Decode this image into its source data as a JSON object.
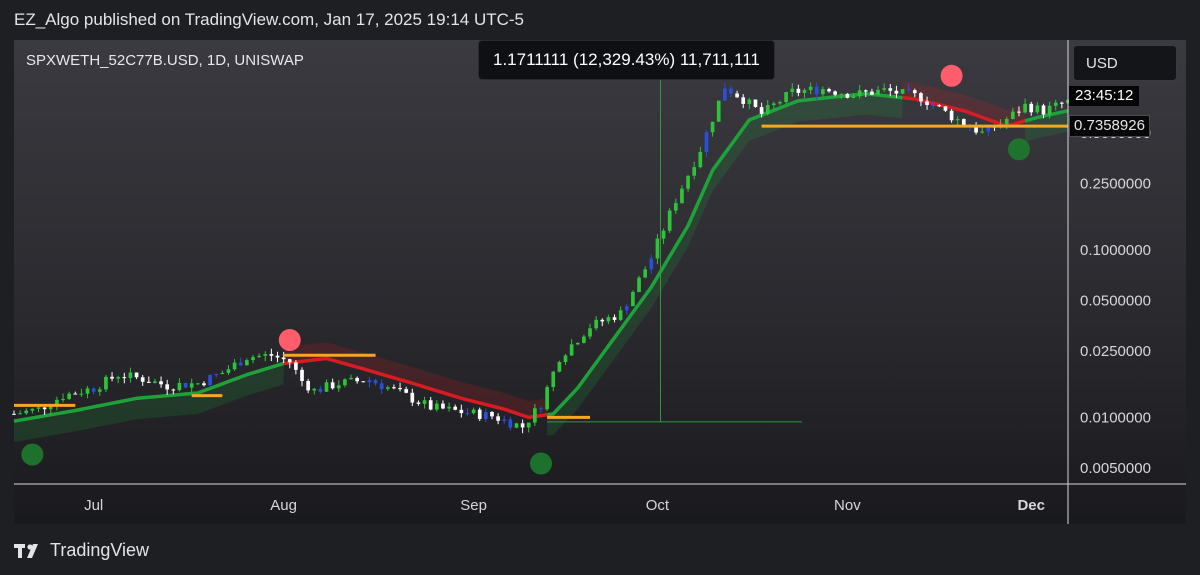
{
  "header": {
    "published_line": "EZ_Algo published on TradingView.com, Jan 17, 2025 19:14 UTC-5"
  },
  "symbol": {
    "title": "SPXWETH_52C77B.USD, 1D, UNISWAP"
  },
  "measure_tooltip": "1.1711111 (12,329.43%) 11,711,111",
  "currency_button": "USD",
  "countdown_label": "23:45:12",
  "last_price_label": "0.7358926",
  "footer": {
    "brand": "TradingView"
  },
  "colors": {
    "bull_candle": "#2ec43a",
    "bear_candle": "#ffffff",
    "blue_candle": "#2b4fd8",
    "up_trend": "#1fa83a",
    "down_trend": "#e01b22",
    "support_line": "#f5a623",
    "sell_signal": "#ff5c6c",
    "buy_signal": "#1e7a2e"
  },
  "chart_data": {
    "type": "candlestick",
    "y_scale": "log",
    "ylim": [
      0.004,
      1.8
    ],
    "y_ticks": [
      {
        "value": 0.5,
        "label": "0.5000000"
      },
      {
        "value": 0.25,
        "label": "0.2500000"
      },
      {
        "value": 0.1,
        "label": "0.1000000"
      },
      {
        "value": 0.05,
        "label": "0.0500000"
      },
      {
        "value": 0.025,
        "label": "0.0250000"
      },
      {
        "value": 0.01,
        "label": "0.0100000"
      },
      {
        "value": 0.005,
        "label": "0.0050000"
      }
    ],
    "x_ticks": [
      {
        "date": "2024-07-01",
        "label": "Jul",
        "bold": false
      },
      {
        "date": "2024-08-01",
        "label": "Aug",
        "bold": false
      },
      {
        "date": "2024-09-01",
        "label": "Sep",
        "bold": false
      },
      {
        "date": "2024-10-01",
        "label": "Oct",
        "bold": false
      },
      {
        "date": "2024-11-01",
        "label": "Nov",
        "bold": false
      },
      {
        "date": "2024-12-01",
        "label": "Dec",
        "bold": true
      }
    ],
    "x_range": [
      "2024-06-18",
      "2024-12-07"
    ],
    "close_path": [
      [
        "2024-06-18",
        0.0105
      ],
      [
        "2024-06-22",
        0.0112
      ],
      [
        "2024-06-26",
        0.0135
      ],
      [
        "2024-07-01",
        0.015
      ],
      [
        "2024-07-05",
        0.018
      ],
      [
        "2024-07-09",
        0.017
      ],
      [
        "2024-07-13",
        0.0155
      ],
      [
        "2024-07-18",
        0.016
      ],
      [
        "2024-07-22",
        0.0185
      ],
      [
        "2024-07-26",
        0.023
      ],
      [
        "2024-07-30",
        0.0235
      ],
      [
        "2024-08-02",
        0.0215
      ],
      [
        "2024-08-04",
        0.0165
      ],
      [
        "2024-08-06",
        0.0145
      ],
      [
        "2024-08-10",
        0.016
      ],
      [
        "2024-08-15",
        0.0168
      ],
      [
        "2024-08-20",
        0.014
      ],
      [
        "2024-08-25",
        0.0115
      ],
      [
        "2024-08-30",
        0.0108
      ],
      [
        "2024-09-04",
        0.0102
      ],
      [
        "2024-09-09",
        0.0088
      ],
      [
        "2024-09-12",
        0.012
      ],
      [
        "2024-09-15",
        0.023
      ],
      [
        "2024-09-20",
        0.035
      ],
      [
        "2024-09-25",
        0.042
      ],
      [
        "2024-09-30",
        0.09
      ],
      [
        "2024-10-04",
        0.2
      ],
      [
        "2024-10-08",
        0.4
      ],
      [
        "2024-10-12",
        0.95
      ],
      [
        "2024-10-15",
        0.8
      ],
      [
        "2024-10-18",
        0.65
      ],
      [
        "2024-10-23",
        0.88
      ],
      [
        "2024-10-28",
        0.92
      ],
      [
        "2024-11-02",
        0.85
      ],
      [
        "2024-11-07",
        0.9
      ],
      [
        "2024-11-13",
        0.82
      ],
      [
        "2024-11-18",
        0.63
      ],
      [
        "2024-11-23",
        0.5
      ],
      [
        "2024-11-26",
        0.57
      ],
      [
        "2024-11-30",
        0.73
      ],
      [
        "2024-12-03",
        0.68
      ],
      [
        "2024-12-07",
        0.77
      ]
    ],
    "trend_line": [
      [
        "2024-06-18",
        0.0095
      ],
      [
        "2024-06-28",
        0.011
      ],
      [
        "2024-07-08",
        0.013
      ],
      [
        "2024-07-18",
        0.014
      ],
      [
        "2024-07-26",
        0.018
      ],
      [
        "2024-08-01",
        0.021
      ],
      [
        "2024-08-08",
        0.0225
      ],
      [
        "2024-08-14",
        0.0195
      ],
      [
        "2024-08-22",
        0.016
      ],
      [
        "2024-08-30",
        0.013
      ],
      [
        "2024-09-06",
        0.0112
      ],
      [
        "2024-09-10",
        0.01
      ],
      [
        "2024-09-14",
        0.0105
      ],
      [
        "2024-09-18",
        0.015
      ],
      [
        "2024-09-24",
        0.03
      ],
      [
        "2024-09-30",
        0.06
      ],
      [
        "2024-10-06",
        0.14
      ],
      [
        "2024-10-10",
        0.3
      ],
      [
        "2024-10-16",
        0.6
      ],
      [
        "2024-10-24",
        0.78
      ],
      [
        "2024-11-04",
        0.86
      ],
      [
        "2024-11-12",
        0.8
      ],
      [
        "2024-11-20",
        0.68
      ],
      [
        "2024-11-27",
        0.55
      ],
      [
        "2024-12-02",
        0.62
      ],
      [
        "2024-12-07",
        0.68
      ]
    ],
    "trend_segments": [
      {
        "start": "2024-06-18",
        "end": "2024-08-01",
        "direction": "up"
      },
      {
        "start": "2024-08-01",
        "end": "2024-09-13",
        "direction": "down"
      },
      {
        "start": "2024-09-13",
        "end": "2024-11-10",
        "direction": "up"
      },
      {
        "start": "2024-11-10",
        "end": "2024-11-30",
        "direction": "down"
      },
      {
        "start": "2024-11-30",
        "end": "2024-12-07",
        "direction": "up"
      }
    ],
    "support_levels": [
      {
        "start": "2024-06-18",
        "end": "2024-06-28",
        "value": 0.0118
      },
      {
        "start": "2024-07-17",
        "end": "2024-07-22",
        "value": 0.0135
      },
      {
        "start": "2024-08-01",
        "end": "2024-08-16",
        "value": 0.0235
      },
      {
        "start": "2024-09-13",
        "end": "2024-09-20",
        "value": 0.01
      },
      {
        "start": "2024-10-18",
        "end": "2024-12-07",
        "value": 0.55
      }
    ],
    "signals": [
      {
        "type": "sell",
        "date": "2024-08-02",
        "value": 0.029
      },
      {
        "type": "sell",
        "date": "2024-11-18",
        "value": 1.1
      },
      {
        "type": "buy",
        "date": "2024-06-21",
        "value": 0.006
      },
      {
        "type": "buy",
        "date": "2024-09-12",
        "value": 0.0053
      },
      {
        "type": "buy",
        "date": "2024-11-29",
        "value": 0.4
      }
    ],
    "measure": {
      "start_date": "2024-09-13",
      "end_date": "2024-10-20",
      "low": 0.0094,
      "high": 1.18
    }
  }
}
